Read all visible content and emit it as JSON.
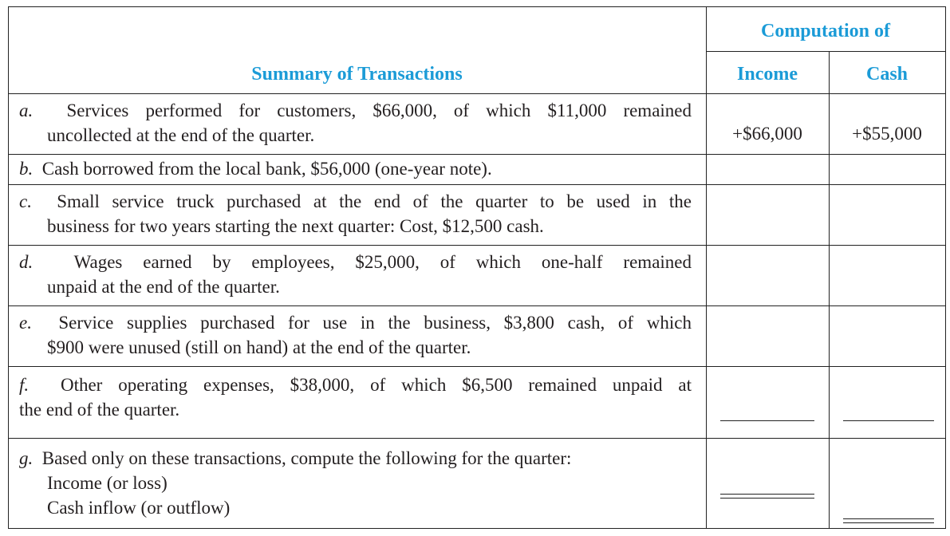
{
  "header": {
    "group_title": "Computation of",
    "summary_title": "Summary of Transactions",
    "income_title": "Income",
    "cash_title": "Cash"
  },
  "rows": [
    {
      "letter": "a.",
      "lines": [
        "Services performed for customers, $66,000, of which $11,000 remained",
        "uncollected at the end of the quarter."
      ],
      "income": "+$66,000",
      "cash": "+$55,000"
    },
    {
      "letter": "b.",
      "lines": [
        "Cash borrowed from the local bank, $56,000 (one-year note)."
      ],
      "income": "",
      "cash": ""
    },
    {
      "letter": "c.",
      "lines": [
        "Small service truck purchased at the end of the quarter to be used in the",
        "business for two years starting the next quarter: Cost, $12,500 cash."
      ],
      "income": "",
      "cash": ""
    },
    {
      "letter": "d.",
      "lines": [
        "Wages earned by employees, $25,000, of which one-half remained",
        "unpaid at the end of the quarter."
      ],
      "income": "",
      "cash": ""
    },
    {
      "letter": "e.",
      "lines": [
        "Service supplies purchased for use in the business, $3,800 cash, of which",
        "$900 were unused (still on hand) at the end of the quarter."
      ],
      "income": "",
      "cash": ""
    },
    {
      "letter": "f.",
      "lines": [
        "Other operating expenses, $38,000, of which $6,500 remained unpaid at",
        "the end of the quarter."
      ],
      "income": "",
      "cash": ""
    },
    {
      "letter": "g.",
      "lines": [
        "Based only on these transactions, compute the following for the quarter:",
        "Income (or loss)",
        "Cash inflow (or outflow)"
      ],
      "income": "",
      "cash": ""
    }
  ]
}
